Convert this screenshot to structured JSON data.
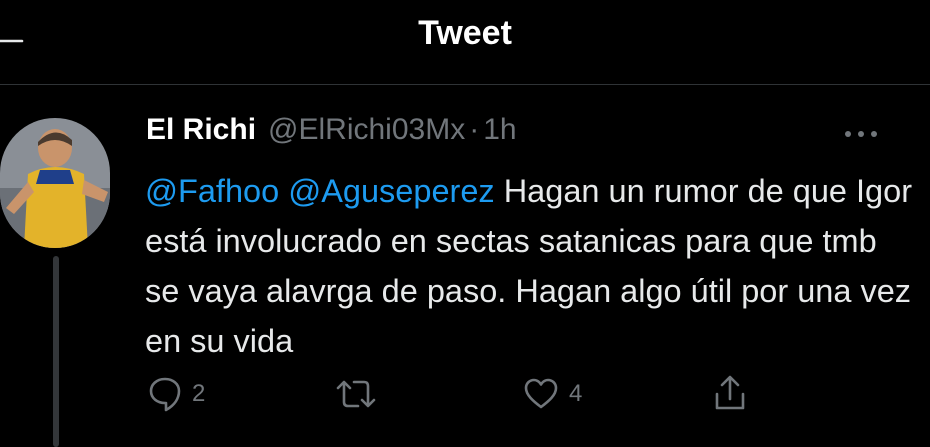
{
  "header": {
    "title": "Tweet"
  },
  "tweet": {
    "author_name": "El Richi",
    "author_handle": "@ElRichi03Mx",
    "separator": "·",
    "time": "1h",
    "mention_1": "@Fafhoo",
    "mention_2": "@Aguseperez",
    "body": "Hagan un rumor de que Igor está involucrado en sectas satanicas para que tmb se vaya alavrga de paso. Hagan algo útil por una vez en su vida"
  },
  "actions": {
    "reply_count": "2",
    "like_count": "4"
  },
  "icons": {
    "back": "arrow-left-icon",
    "more": "more-horizontal-icon",
    "reply": "reply-bubble-icon",
    "retweet": "retweet-icon",
    "like": "heart-icon",
    "share": "share-upload-icon"
  },
  "colors": {
    "background": "#000000",
    "text": "#e7e9ea",
    "secondary": "#71767b",
    "accent": "#1d9bf0"
  }
}
